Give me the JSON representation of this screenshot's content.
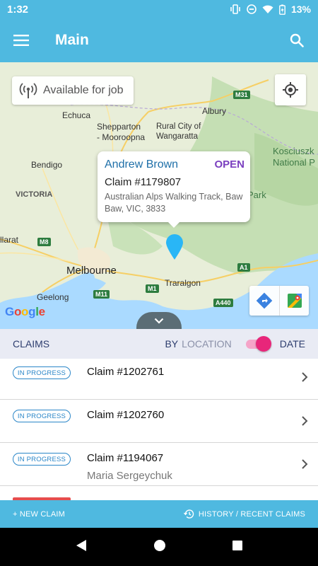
{
  "status_bar": {
    "time": "1:32",
    "battery": "13%",
    "icons": [
      "vibrate-icon",
      "do-not-disturb-icon",
      "wifi-icon",
      "battery-charging-icon"
    ]
  },
  "app_bar": {
    "title": "Main",
    "icons": [
      "menu-icon",
      "search-icon"
    ]
  },
  "map": {
    "availability_label": "Available for job",
    "labels": {
      "echuca": "Echuca",
      "shepparton": "Shepparton\n- Mooroopna",
      "bendigo": "Bendigo",
      "victoria": "VICTORIA",
      "melbourne": "Melbourne",
      "geelong": "Geelong",
      "albury": "Albury",
      "rural_city": "Rural City of\nWangaratta",
      "kosciuszko": "Kosciuszk\nNational P",
      "park": "Park",
      "traralgon": "Traralgon",
      "allarat": "llarat"
    },
    "road_shields": [
      "M31",
      "M8",
      "M11",
      "M1",
      "A1",
      "A440"
    ],
    "info_window": {
      "name": "Andrew Brown",
      "status": "OPEN",
      "claim": "Claim #1179807",
      "address": "Australian Alps Walking Track, Baw Baw, VIC, 3833"
    },
    "attribution": "Google",
    "colors": {
      "pin": "#29b6f6",
      "water": "#aadaff",
      "land": "#e8eed9",
      "forest": "#c5dfb4"
    }
  },
  "claims_header": {
    "title": "CLAIMS",
    "sort_by": "BY",
    "sort_location": "LOCATION",
    "sort_date": "DATE",
    "toggle_state": "date"
  },
  "claims": [
    {
      "status": "IN PROGRESS",
      "title": "Claim #1202761",
      "subtitle": ""
    },
    {
      "status": "IN PROGRESS",
      "title": "Claim #1202760",
      "subtitle": ""
    },
    {
      "status": "IN PROGRESS",
      "title": "Claim #1194067",
      "subtitle": "Maria Sergeychuk"
    }
  ],
  "action_bar": {
    "new_claim": "+ NEW CLAIM",
    "history": "HISTORY / RECENT CLAIMS"
  },
  "colors": {
    "primary": "#4fb9e0",
    "accent_pink": "#e8267a",
    "status_blue": "#2a86c8",
    "open_purple": "#7a3fbf",
    "header_bg": "#e9ebf4"
  }
}
